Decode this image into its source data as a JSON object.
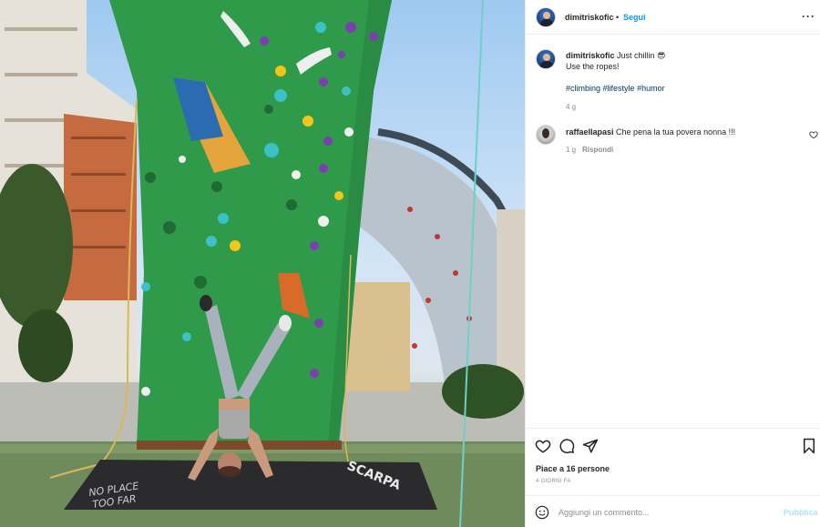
{
  "post": {
    "username": "dimitriskofic",
    "separator": "•",
    "follow_label": "Segui",
    "more_label": "•••",
    "caption_line1": "Just chillin 😎",
    "caption_line2": "Use the ropes!",
    "hashtags": [
      "#climbing",
      "#lifestyle",
      "#humor"
    ],
    "caption_age": "4 g"
  },
  "photo": {
    "mat_text_left_1": "NO PLACE",
    "mat_text_left_2": "TOO FAR",
    "mat_brand": "SCARPA"
  },
  "comments": [
    {
      "username": "raffaellapasi",
      "text": "Che pena la tua povera nonna !!!",
      "age": "1 g",
      "reply_label": "Rispondi"
    }
  ],
  "actions": {
    "like_icon": "heart-icon",
    "comment_icon": "comment-icon",
    "share_icon": "paper-plane-icon",
    "save_icon": "bookmark-icon",
    "likes_text": "Piace a 16 persone",
    "date_text": "4 GIORNI FA"
  },
  "comment_bar": {
    "emoji_icon": "smiley-icon",
    "placeholder": "Aggiungi un commento...",
    "publish_label": "Pubblica"
  },
  "colors": {
    "link_blue": "#0095f6",
    "hashtag_blue": "#00376b",
    "muted_gray": "#8e8e8e",
    "publish_disabled": "#b2dffc"
  }
}
